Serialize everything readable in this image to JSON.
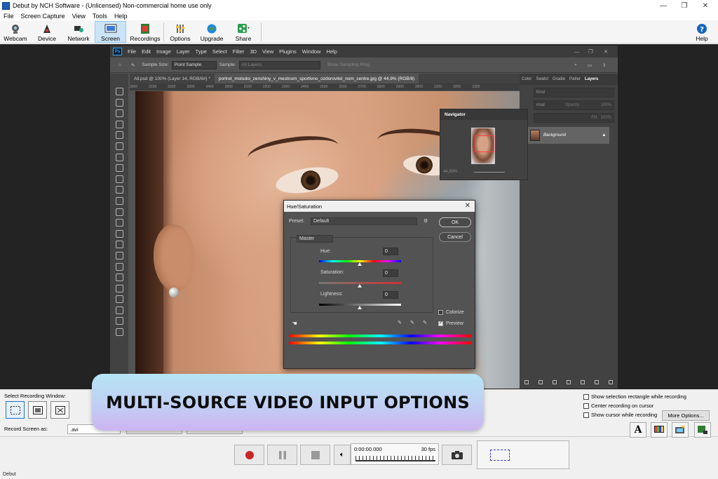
{
  "window": {
    "title": "Debut by NCH Software - (Unlicensed) Non-commercial home use only"
  },
  "menu": [
    "File",
    "Screen Capture",
    "View",
    "Tools",
    "Help"
  ],
  "toolbar": {
    "webcam": "Webcam",
    "device": "Device",
    "network": "Network",
    "screen": "Screen",
    "recordings": "Recordings",
    "options": "Options",
    "upgrade": "Upgrade",
    "share": "Share",
    "help": "Help"
  },
  "photoshop": {
    "menu": [
      "File",
      "Edit",
      "Image",
      "Layer",
      "Type",
      "Select",
      "Filter",
      "3D",
      "View",
      "Plugins",
      "Window",
      "Help"
    ],
    "options": {
      "sample_size_label": "Sample Size:",
      "sample_size_value": "Point Sample",
      "sample_label": "Sample:",
      "sample_value": "All Layers",
      "show_ring": "Show Sampling Ring"
    },
    "tabs": [
      "All.psd @ 100% (Layer 14, RGB/8#) *",
      "portret_molodoi_zenshiny_v_mestnom_sportivno_ozdorovitel_nom_centre.jpg @ 44,9% (RGB/8)"
    ],
    "ruler": [
      "3000",
      "3100",
      "3200",
      "3300",
      "3400",
      "3500",
      "2100",
      "2200",
      "2300",
      "2400",
      "2500",
      "2600",
      "2700",
      "2800",
      "2900",
      "3000",
      "3100",
      "3200",
      "3300"
    ],
    "panel_tabs": [
      "Color",
      "Swatcl",
      "Gradie",
      "Patter",
      "Layers"
    ],
    "kind_label": "Kind",
    "blend_label": "rmal",
    "opacity_label": "Opacity:",
    "opacity_value": "100%",
    "fill_label": "Fill:",
    "fill_value": "100%",
    "layer_name": "Background",
    "navigator": {
      "title": "Navigator",
      "zoom": "44,93%"
    }
  },
  "hue_saturation": {
    "title": "Hue/Saturation",
    "preset_label": "Preset:",
    "preset_value": "Default",
    "ok": "OK",
    "cancel": "Cancel",
    "channel": "Master",
    "hue_label": "Hue:",
    "hue_value": "0",
    "saturation_label": "Saturation:",
    "saturation_value": "0",
    "lightness_label": "Lightness:",
    "lightness_value": "0",
    "colorize": "Colorize",
    "preview": "Preview"
  },
  "recording": {
    "select_window_label": "Select Recording Window:",
    "options": [
      "Show selection rectangle while recording",
      "Center recording on cursor",
      "Show cursor while recording"
    ],
    "more_options": "More Options...",
    "record_as_label": "Record Screen as:",
    "format": ".avi",
    "time": "0:00:00.000",
    "fps": "30 fps"
  },
  "banner": "MULTI-SOURCE VIDEO INPUT OPTIONS",
  "status": "Debut"
}
